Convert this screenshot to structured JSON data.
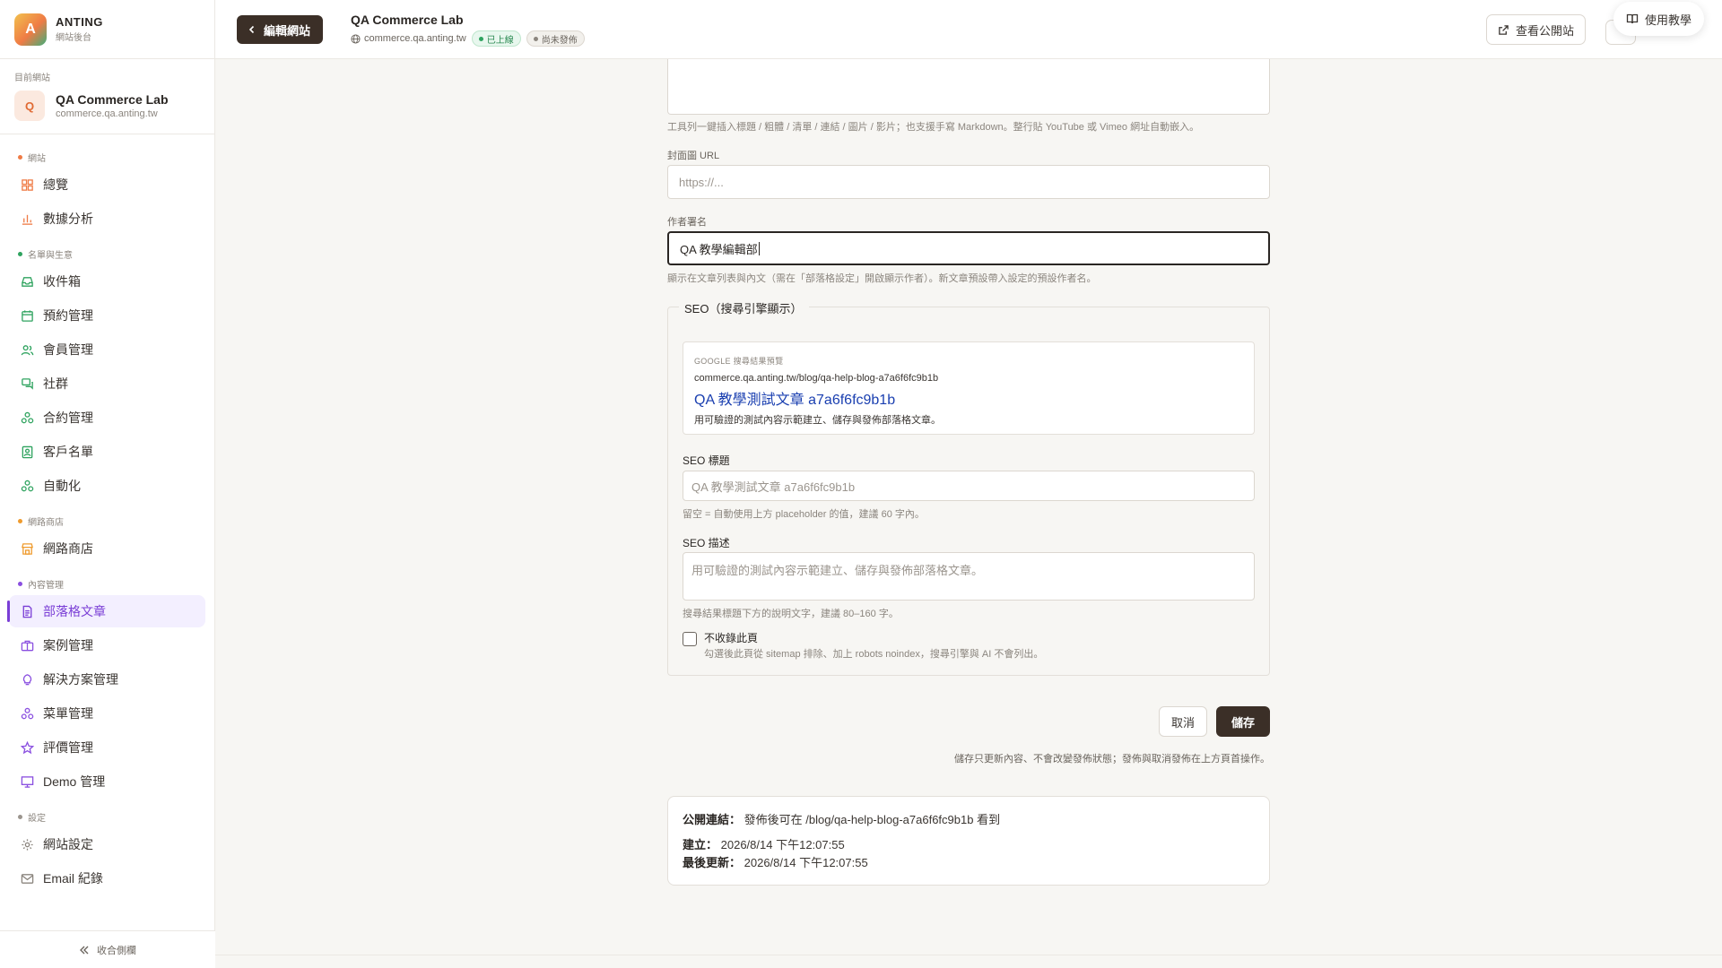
{
  "brand": {
    "logo_letter": "A",
    "name": "ANTING",
    "subtitle": "網站後台"
  },
  "current_site": {
    "caption": "目前網站",
    "avatar_letter": "Q",
    "name": "QA Commerce Lab",
    "domain": "commerce.qa.anting.tw"
  },
  "nav": {
    "groups": [
      {
        "label": "網站",
        "dot_color": "#ef7b45"
      },
      {
        "label": "名單與生意",
        "dot_color": "#2fa35f"
      },
      {
        "label": "網路商店",
        "dot_color": "#ef9b2e"
      },
      {
        "label": "內容管理",
        "dot_color": "#8a4fe0"
      },
      {
        "label": "設定",
        "dot_color": "#9b958e"
      }
    ],
    "items": {
      "overview": "總覽",
      "analytics": "數據分析",
      "inbox": "收件箱",
      "bookings": "預約管理",
      "members": "會員管理",
      "community": "社群",
      "contracts": "合約管理",
      "clients": "客戶名單",
      "automation": "自動化",
      "shop": "網路商店",
      "blog": "部落格文章",
      "cases": "案例管理",
      "solutions": "解決方案管理",
      "menu": "菜單管理",
      "reviews": "評價管理",
      "demo": "Demo 管理",
      "site_settings": "網站設定",
      "email_log": "Email 紀錄"
    },
    "collapse_label": "收合側欄"
  },
  "header": {
    "edit_site_label": "編輯網站",
    "site_name": "QA Commerce Lab",
    "site_domain": "commerce.qa.anting.tw",
    "badge_live": "已上線",
    "badge_unpublished": "尚未發佈",
    "view_site_label": "查看公開站",
    "tutorial_label": "使用教學"
  },
  "form": {
    "editor_hint": "工具列一鍵插入標題 / 粗體 / 清單 / 連結 / 圖片 / 影片；也支援手寫 Markdown。整行貼 YouTube 或 Vimeo 網址自動嵌入。",
    "cover_label": "封面圖 URL",
    "cover_placeholder": "https://...",
    "author_label": "作者署名",
    "author_value": "QA 教學編輯部",
    "author_hint": "顯示在文章列表與內文（需在「部落格設定」開啟顯示作者）。新文章預設帶入設定的預設作者名。"
  },
  "seo": {
    "legend": "SEO（搜尋引擎顯示）",
    "preview_caption": "GOOGLE 搜尋結果預覽",
    "preview_url": "commerce.qa.anting.tw/blog/qa-help-blog-a7a6f6fc9b1b",
    "preview_title": "QA 教學測試文章 a7a6f6fc9b1b",
    "preview_desc": "用可驗證的測試內容示範建立、儲存與發佈部落格文章。",
    "title_label": "SEO 標題",
    "title_placeholder": "QA 教學測試文章 a7a6f6fc9b1b",
    "title_hint": "留空 = 自動使用上方 placeholder 的值，建議 60 字內。",
    "desc_label": "SEO 描述",
    "desc_placeholder": "用可驗證的測試內容示範建立、儲存與發佈部落格文章。",
    "desc_hint": "搜尋結果標題下方的說明文字，建議 80–160 字。",
    "noindex_label": "不收錄此頁",
    "noindex_hint": "勾選後此頁從 sitemap 排除、加上 robots noindex，搜尋引擎與 AI 不會列出。",
    "noindex_checked": false
  },
  "actions": {
    "cancel_label": "取消",
    "save_label": "儲存",
    "save_note": "儲存只更新內容、不會改變發佈狀態；發佈與取消發佈在上方頁首操作。"
  },
  "meta": {
    "public_link_label": "公開連結：",
    "public_link_value": "發佈後可在 /blog/qa-help-blog-a7a6f6fc9b1b 看到",
    "created_label": "建立：",
    "created_value": "2026/8/14 下午12:07:55",
    "updated_label": "最後更新：",
    "updated_value": "2026/8/14 下午12:07:55"
  }
}
